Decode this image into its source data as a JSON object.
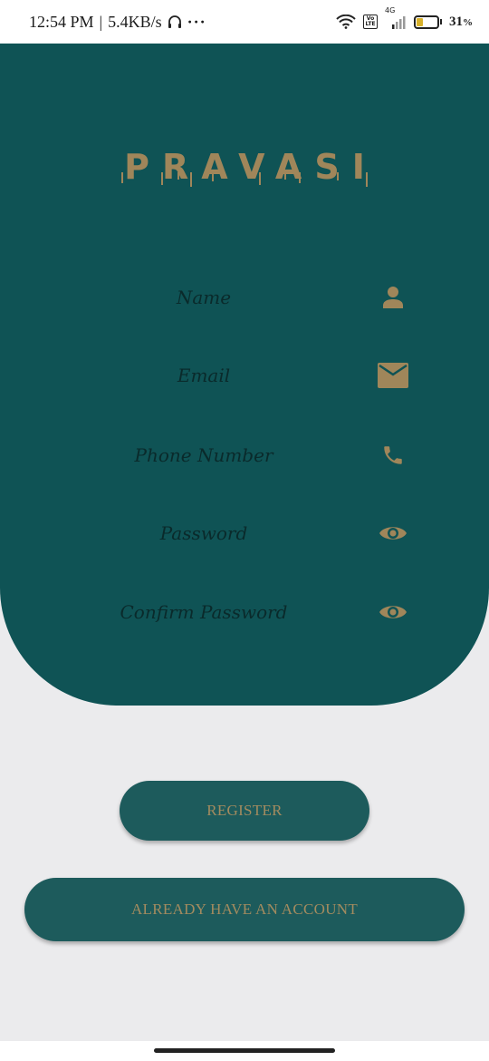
{
  "status_bar": {
    "time": "12:54 PM",
    "separator": "|",
    "network_speed": "5.4KB/s",
    "more": "···",
    "network_type": "4G",
    "volte": "Vo LTE",
    "battery_percent": "31",
    "battery_unit": "%",
    "battery_level": 0.31,
    "icons": [
      "headphones-icon",
      "wifi-icon",
      "volte-icon",
      "signal-icon",
      "battery-icon"
    ]
  },
  "app": {
    "brand_title": "PRAVASI",
    "accent_color": "#a0865a",
    "panel_color": "#0f5355"
  },
  "form": {
    "fields": [
      {
        "placeholder": "Name",
        "icon": "person-icon"
      },
      {
        "placeholder": "Email",
        "icon": "mail-icon"
      },
      {
        "placeholder": "Phone Number",
        "icon": "phone-icon"
      },
      {
        "placeholder": "Password",
        "icon": "eye-icon"
      },
      {
        "placeholder": "Confirm Password",
        "icon": "eye-icon"
      }
    ]
  },
  "actions": {
    "register_label": "REGISTER",
    "login_label": "ALREADY HAVE AN ACCOUNT"
  }
}
